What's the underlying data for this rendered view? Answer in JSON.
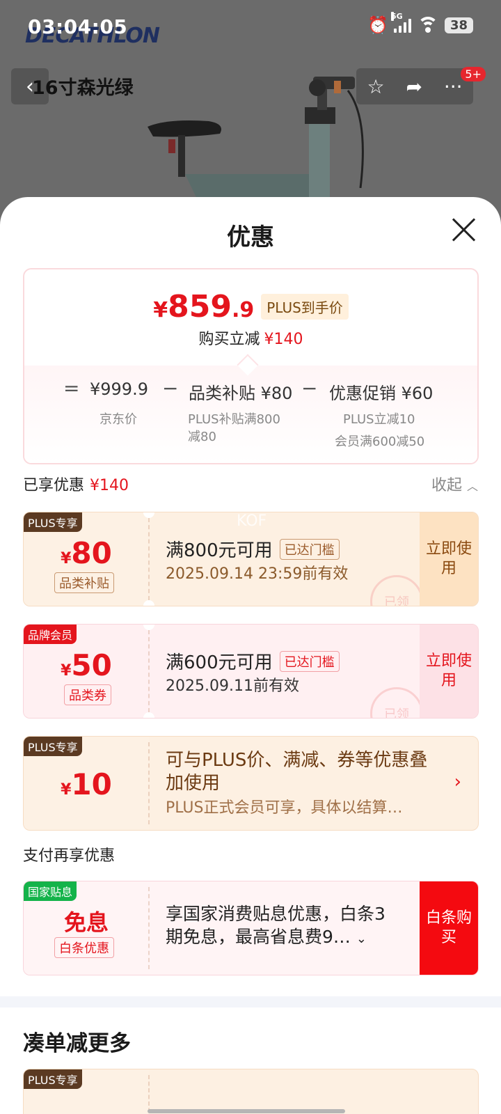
{
  "status_bar": {
    "time": "03:04:05",
    "network": "5G",
    "battery": "38"
  },
  "product_page": {
    "brand": "DECATHLON",
    "title": "16寸森光绿",
    "cart_badge": "5+"
  },
  "sheet": {
    "title": "优惠",
    "price_summary": {
      "currency": "¥",
      "price_int": "859",
      "price_dec": ".9",
      "price_tag": "PLUS到手价",
      "buy_off_label": "购买立减",
      "buy_off_amount": "¥140",
      "equals": "=",
      "minus": "−",
      "jd_price": "¥999.9",
      "jd_price_label": "京东价",
      "subsidy": "品类补贴 ¥80",
      "subsidy_note_1": "PLUS补贴满800",
      "subsidy_note_2": "减80",
      "promo": "优惠促销 ¥60",
      "promo_note_1": "PLUS立减10",
      "promo_note_2": "会员满600减50"
    },
    "enjoyed": {
      "label": "已享优惠",
      "amount": "¥140",
      "collapse": "收起"
    },
    "coupons": [
      {
        "tag": "PLUS专享",
        "currency": "¥",
        "amount": "80",
        "kind": "品类补贴",
        "condition": "满800元可用",
        "reached": "已达门槛",
        "expire": "2025.09.14 23:59前有效",
        "button": "立即使用",
        "stamp": "已领",
        "watermark": "KOF"
      },
      {
        "tag": "品牌会员",
        "currency": "¥",
        "amount": "50",
        "kind": "品类券",
        "condition": "满600元可用",
        "reached": "已达门槛",
        "expire": "2025.09.11前有效",
        "button": "立即使用",
        "stamp": "已领"
      },
      {
        "tag": "PLUS专享",
        "currency": "¥",
        "amount": "10",
        "desc1": "可与PLUS价、满减、券等优惠叠加使用",
        "desc2": "PLUS正式会员可享，具体以结算…"
      }
    ],
    "pay_section": {
      "title": "支付再享优惠",
      "tag": "国家贴息",
      "headline": "免息",
      "kind": "白条优惠",
      "desc": "享国家消费贴息优惠，白条3期免息，最高省息费9…",
      "button": "白条购买"
    },
    "more": {
      "title": "凑单减更多",
      "tag": "PLUS专享"
    }
  },
  "colors": {
    "accent_red": "#e4151d",
    "plus_brown": "#5b3a22",
    "gov_green": "#14b34a"
  }
}
